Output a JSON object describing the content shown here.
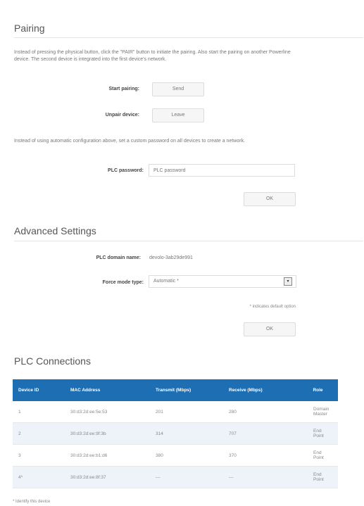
{
  "pairing": {
    "title": "Pairing",
    "desc1": "Instead of pressing the physical button, click the \"PAIR\" button to initiate the pairing. Also start the pairing on another Powerline device. The second device is integrated into the first device's network.",
    "start_pairing_label": "Start pairing:",
    "start_button": "Send",
    "unpair_label": "Unpair device:",
    "unpair_button": "Leave",
    "desc2": "Instead of using automatic configuration above, set a custom password on all devices to create a network.",
    "plc_password_label": "PLC password:",
    "plc_password_placeholder": "PLC password",
    "ok_button": "OK"
  },
  "advanced": {
    "title": "Advanced Settings",
    "domain_label": "PLC domain name:",
    "domain_value": "devolo-3ab29de991",
    "force_mode_label": "Force mode type:",
    "force_mode_value": "Automatic *",
    "default_note": "* indicates default option",
    "ok_button": "OK"
  },
  "connections": {
    "title": "PLC Connections",
    "columns": [
      "Device ID",
      "MAC Address",
      "Transmit (Mbps)",
      "Receive (Mbps)",
      "Role"
    ],
    "rows": [
      [
        "1",
        "30:d3:2d:ee:5e:53",
        "201",
        "280",
        "Domain Master"
      ],
      [
        "2",
        "30:d3:2d:ee:9f:3b",
        "314",
        "707",
        "End Point"
      ],
      [
        "3",
        "30:d3:2d:ee:b1:d6",
        "380",
        "370",
        "End Point"
      ],
      [
        "4*",
        "30:d3:2d:ee:8f:37",
        "---",
        "---",
        "End Point"
      ]
    ],
    "footnote": "* Identify this device"
  }
}
